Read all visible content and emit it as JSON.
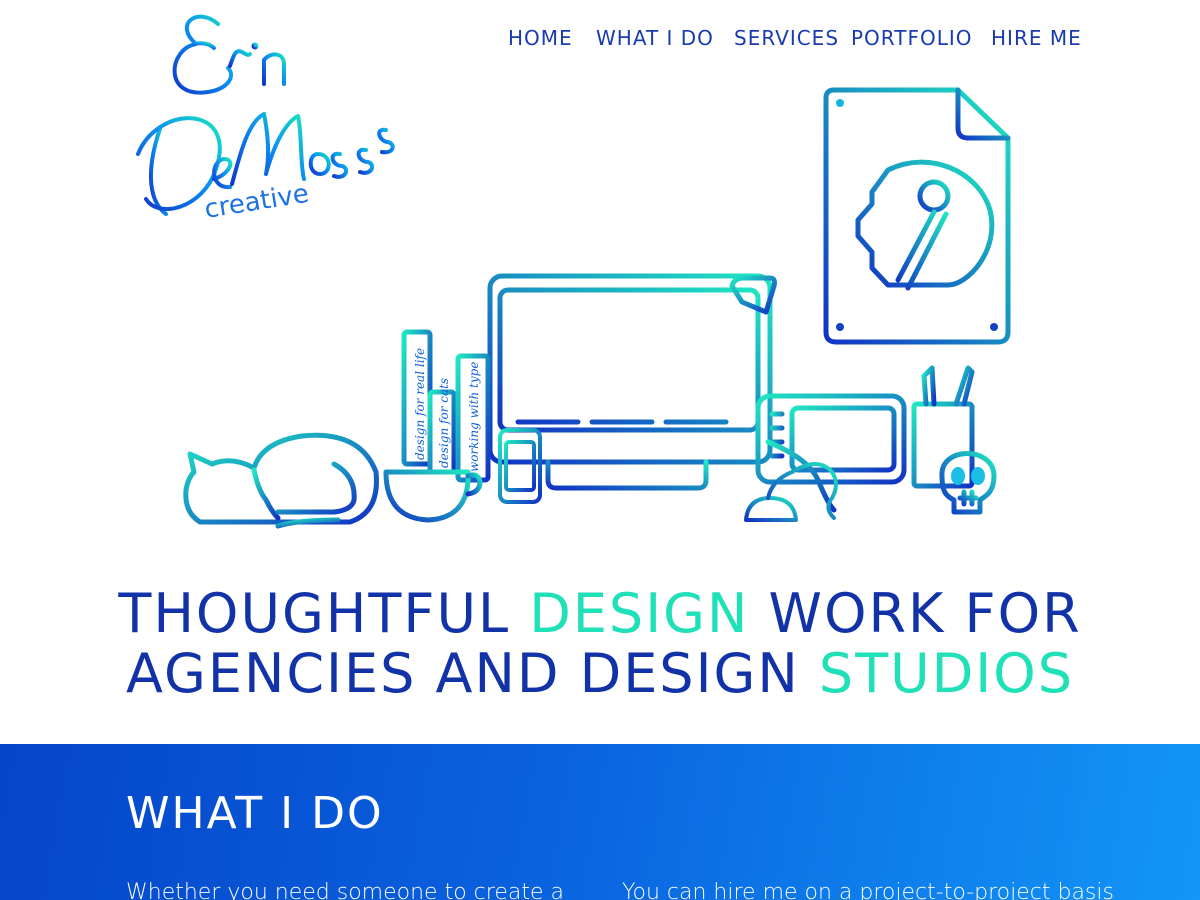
{
  "brand": {
    "logo_text": "Erin DeMoss creative",
    "colors": {
      "navy": "#1232a8",
      "aqua": "#1fe0b6",
      "blue_start": "#0545c9",
      "blue_end": "#1296f7"
    }
  },
  "nav": {
    "items": [
      {
        "label": "HOME"
      },
      {
        "label": "WHAT I DO"
      },
      {
        "label": "SERVICES"
      },
      {
        "label": "PORTFOLIO"
      },
      {
        "label": "HIRE ME"
      }
    ]
  },
  "hero": {
    "book_titles": [
      "design for real life",
      "design for cats",
      "working with type"
    ],
    "icons": [
      "cat-icon",
      "cup-icon",
      "books-icon",
      "monitor-icon",
      "desk-lamp-icon",
      "phone-icon",
      "drawing-tablet-icon",
      "mouse-icon",
      "pencil-cup-icon",
      "skull-icon",
      "poster-icon"
    ]
  },
  "headline": {
    "line1": {
      "part1": "THOUGHTFUL ",
      "accent": "DESIGN",
      "part2": " WORK FOR"
    },
    "line2": {
      "part1": "AGENCIES AND DESIGN ",
      "accent": "STUDIOS"
    }
  },
  "what_i_do": {
    "title": "WHAT I DO",
    "col1_text": "Whether you need someone to create a",
    "col2_text": "You can hire me on a project-to-project basis"
  }
}
